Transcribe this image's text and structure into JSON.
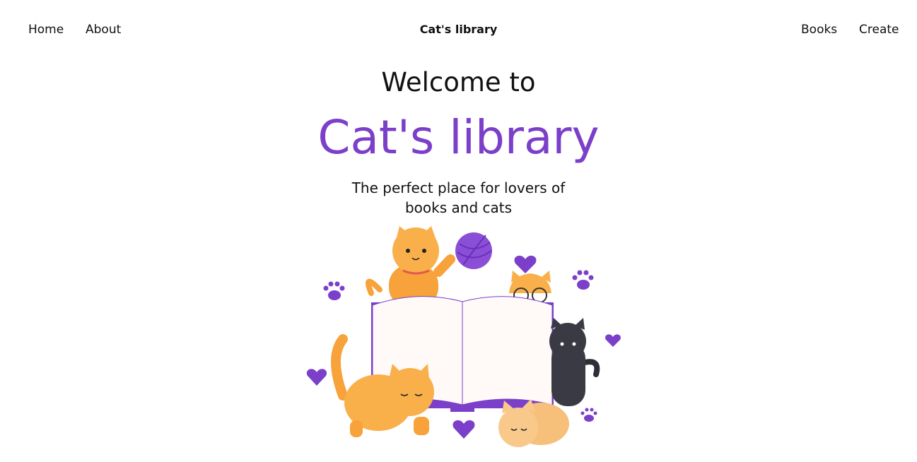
{
  "nav": {
    "home": "Home",
    "about": "About",
    "brand": "Cat's library",
    "books": "Books",
    "create": "Create"
  },
  "hero": {
    "welcome": "Welcome to",
    "title": "Cat's library",
    "tagline_line1": "The perfect place for lovers of",
    "tagline_line2": "books and cats"
  },
  "illustration": {
    "icon": "cats-reading-book-illustration"
  },
  "colors": {
    "accent": "#7b3fc9",
    "text": "#111111",
    "background": "#ffffff",
    "cat_orange": "#f7a23a",
    "cat_dark": "#2e2e36"
  }
}
